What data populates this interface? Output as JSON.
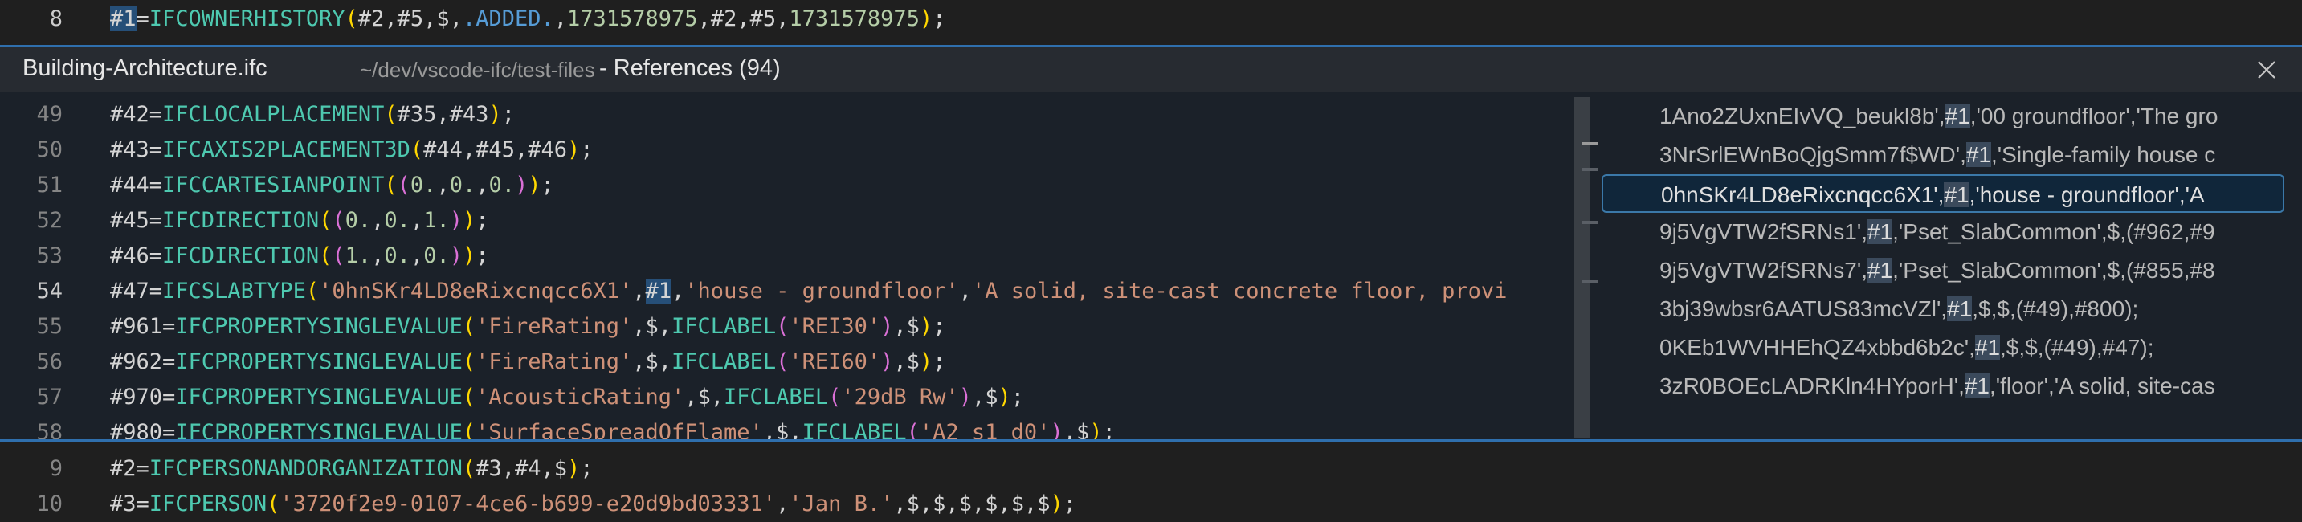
{
  "editor": {
    "top_line": {
      "number": "8"
    },
    "bottom_lines": [
      {
        "number": "9"
      },
      {
        "number": "10"
      }
    ]
  },
  "peek": {
    "file_name": "Building-Architecture.ifc",
    "path": "~/dev/vscode-ifc/test-files",
    "title": "- References (94)",
    "close_label": "Close",
    "line_numbers": [
      "49",
      "50",
      "51",
      "52",
      "53",
      "54",
      "55",
      "56",
      "57",
      "58"
    ],
    "references": [
      {
        "text": "1Ano2ZUxnEIvVQ_beukl8b',#1,'00 groundfloor','The gro"
      },
      {
        "text": "3NrSrlEWnBoQjgSmm7f$WD',#1,'Single-family house c"
      },
      {
        "text": "0hnSKr4LD8eRixcnqcc6X1',#1,'house - groundfloor','A"
      },
      {
        "text": "9j5VgVTW2fSRNs1',#1,'Pset_SlabCommon',$,(#962,#9"
      },
      {
        "text": "9j5VgVTW2fSRNs7',#1,'Pset_SlabCommon',$,(#855,#8"
      },
      {
        "text": "3bj39wbsr6AATUS83mcVZl',#1,$,$,(#49),#800);"
      },
      {
        "text": "0KEb1WVHHEhQZ4xbbd6b2c',#1,$,$,(#49),#47);"
      },
      {
        "text": "3zR0BOEcLADRKln4HYporH',#1,'floor','A solid, site-cas"
      }
    ],
    "selected_index": 2
  },
  "colors": {
    "accent": "#2f6fad",
    "editor_bg": "#1f1f1f",
    "peek_bg": "#1b2129",
    "type": "#4ec9b0",
    "string": "#ce9178",
    "number": "#b5cea8"
  }
}
